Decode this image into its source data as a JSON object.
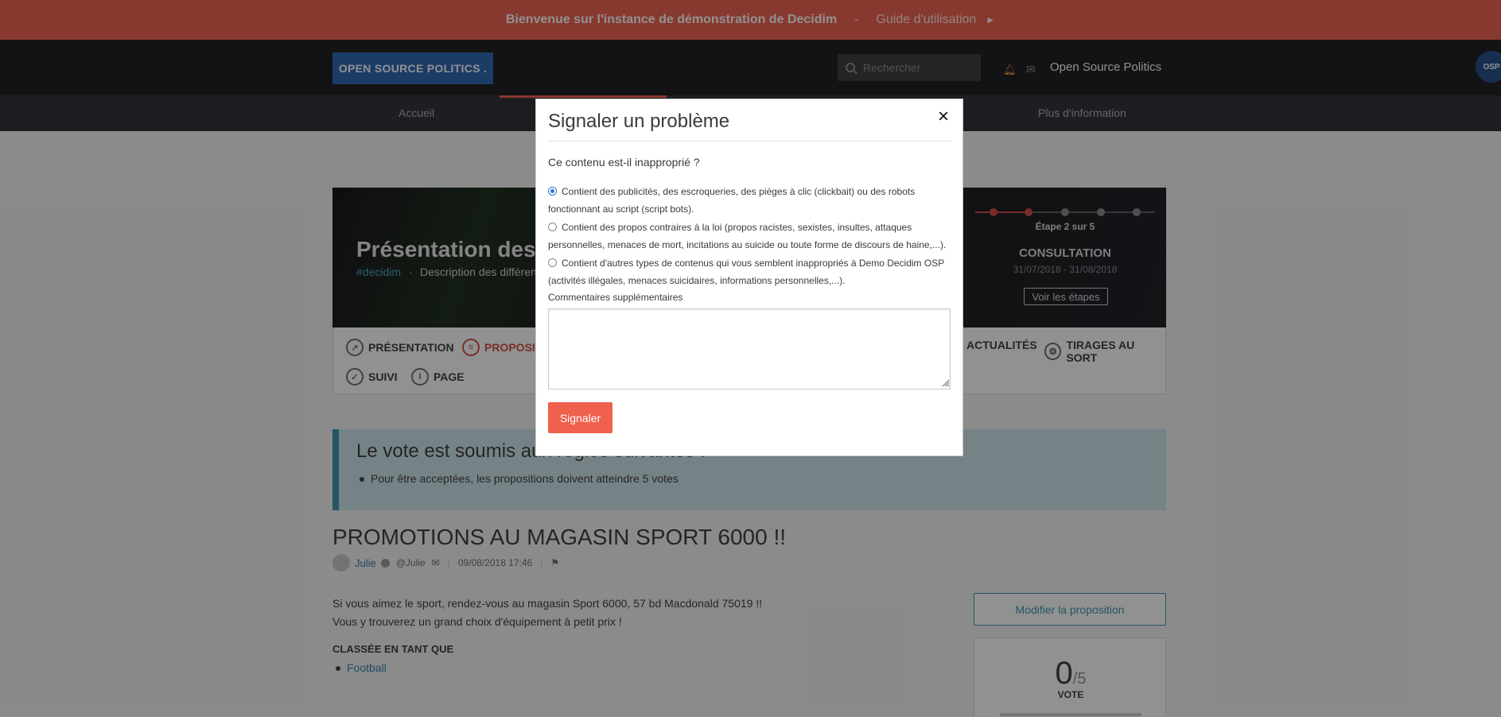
{
  "banner": {
    "welcome": "Bienvenue sur l'instance de démonstration de Decidim",
    "separator": "-",
    "guide": "Guide d'utilisation",
    "arrow": "►"
  },
  "header": {
    "logo": "OPEN SOURCE POLITICS .",
    "search_placeholder": "Rechercher",
    "user_name": "Open Source Politics",
    "avatar_text": "OSP"
  },
  "nav": {
    "items": [
      "Accueil",
      "Plus d'information"
    ]
  },
  "hero": {
    "title": "Présentation des",
    "hashtag": "#decidim",
    "dot": "·",
    "description": "Description des différen",
    "step_label": "Étape 2 sur 5",
    "phase": "CONSULTATION",
    "dates": "31/07/2018 - 31/08/2018",
    "steps_button": "Voir les étapes",
    "steps_total": 5,
    "steps_current": 2
  },
  "tabs": [
    {
      "label": "PRÉSENTATION",
      "icon": "link-icon"
    },
    {
      "label": "PROPOSIT",
      "icon": "speech-icon",
      "active": true
    },
    {
      "label": "ACTUALITÉS",
      "icon": "news-icon"
    },
    {
      "label": "TIRAGES AU SORT",
      "icon": "aperture-icon"
    },
    {
      "label": "SUIVI",
      "icon": "check-icon"
    },
    {
      "label": "PAGE",
      "icon": "info-icon"
    }
  ],
  "callout": {
    "title": "Le vote est soumis aux règles suivantes :",
    "rule": "Pour être acceptées, les propositions doivent atteindre 5 votes"
  },
  "proposal": {
    "title": "PROMOTIONS AU MAGASIN SPORT 6000 !!",
    "author": "Julie",
    "nickname": "@Julie",
    "datetime": "09/08/2018 17:46",
    "body_line1": "Si vous aimez le sport, rendez-vous au magasin Sport 6000, 57 bd Macdonald 75019 !!",
    "body_line2": "Vous y trouverez un grand choix d'équipement à petit prix !",
    "classed_label": "CLASSÉE EN TANT QUE",
    "category": "Football",
    "edit_button": "Modifier la proposition",
    "votes": "0",
    "votes_max": "/5",
    "vote_label": "VOTE"
  },
  "modal": {
    "title": "Signaler un problème",
    "close": "×",
    "question": "Ce contenu est-il inapproprié ?",
    "options": [
      {
        "label": "Contient des publicités, des escroqueries, des pièges à clic (clickbait) ou des robots fonctionnant au script (script bots).",
        "checked": true
      },
      {
        "label": "Contient des propos contraires à la loi (propos racistes, sexistes, insultes, attaques personnelles, menaces de mort, incitations au suicide ou toute forme de discours de haine,...).",
        "checked": false
      },
      {
        "label": "Contient d'autres types de contenus qui vous semblent inappropriés à Demo Decidim OSP (activités illégales, menaces suicidaires, informations personnelles,...).",
        "checked": false
      }
    ],
    "comments_label": "Commentaires supplémentaires",
    "submit": "Signaler"
  },
  "colors": {
    "banner": "#ef604d",
    "header": "#1a181d",
    "logo": "#2a64b4",
    "accent": "#ef604d",
    "link": "#2f7fa6"
  }
}
